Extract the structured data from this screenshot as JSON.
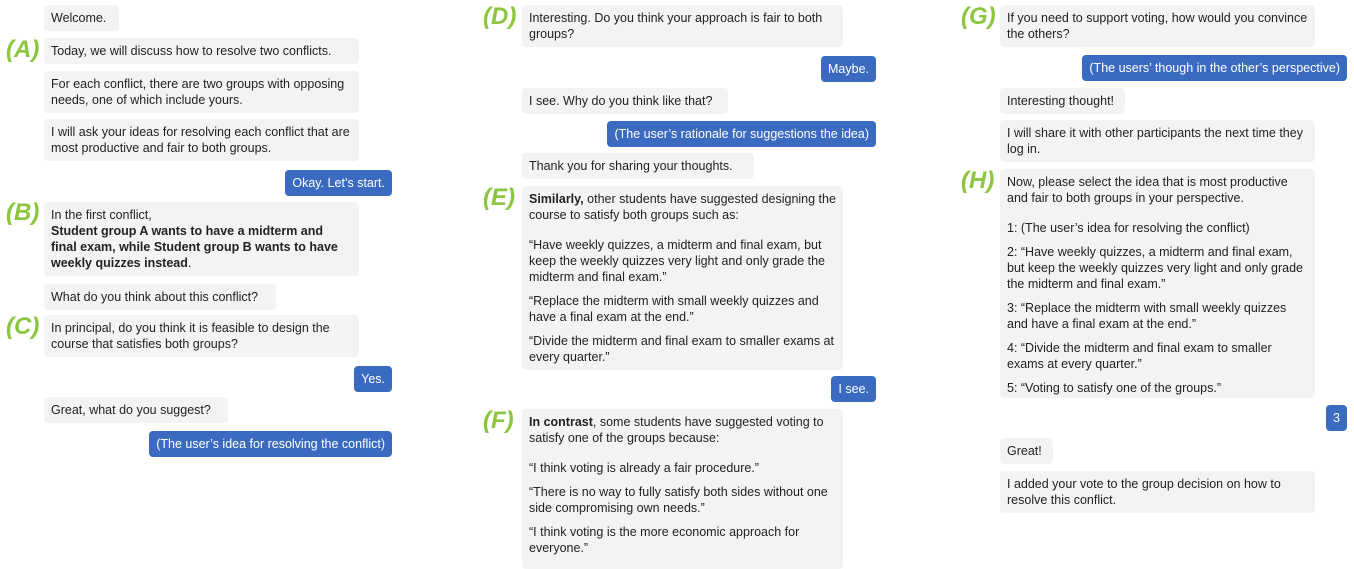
{
  "col1": {
    "welcome": "Welcome.",
    "marker_a": "(A)",
    "today": "Today, we will discuss how to resolve two conflicts.",
    "for_each": "For each conflict, there are two groups with opposing needs, one of which include yours.",
    "ask_ideas": "I will ask your ideas for resolving each conflict that are most productive and fair to both groups.",
    "okay": "Okay. Let’s start.",
    "marker_b": "(B)",
    "first_conflict": "In the first conflict,",
    "conflict_bold": "Student group A wants to have a midterm and final exam, while Student group B wants to have weekly quizzes instead",
    "conflict_end": ".",
    "what_think": "What do you think about this conflict?",
    "marker_c": "(C)",
    "feasible": "In principal, do you think it is feasible to design the course that satisfies both groups?",
    "yes": "Yes.",
    "great_suggest": "Great, what do you suggest?",
    "user_idea": "(The user’s idea for resolving the conflict)"
  },
  "col2": {
    "marker_d": "(D)",
    "fair": "Interesting. Do you think your approach is fair to both groups?",
    "maybe": "Maybe.",
    "why": "I see. Why do you think like that?",
    "rationale": "(The user’s rationale for suggestions the idea)",
    "thanks": "Thank you for sharing your thoughts.",
    "marker_e": "(E)",
    "similarly_bold": "Similarly,",
    "similarly_rest": " other students have suggested designing the course to satisfy both groups such as:",
    "quote1": "“Have weekly quizzes, a midterm and final exam, but keep the weekly quizzes very light and only grade the midterm and final exam.”",
    "quote2": "“Replace the midterm with small weekly quizzes and have a final exam at the end.”",
    "quote3": "“Divide the midterm and final exam to smaller exams at every quarter.”",
    "isee": "I see.",
    "marker_f": "(F)",
    "contrast_bold": "In contrast",
    "contrast_rest": ", some students have suggested voting to satisfy one of the groups because:",
    "vote1": "“I think voting is already a fair procedure.”",
    "vote2": "“There is no way to fully satisfy both sides without one side compromising own needs.”",
    "vote3": "“I think voting is the more economic approach for everyone.”"
  },
  "col3": {
    "marker_g": "(G)",
    "convince": "If you need to support voting, how would you convince the others?",
    "users_though": "(The users’ though in the other’s perspective)",
    "interesting": "Interesting thought!",
    "share": "I will share it with other participants the next time they log in.",
    "marker_h": "(H)",
    "select": "Now, please select the idea that is most productive and fair to both groups in your perspective.",
    "opt1": "1:  (The user’s idea for resolving the conflict)",
    "opt2": "2:  “Have weekly quizzes, a midterm and final exam, but keep the weekly quizzes very light and only grade the midterm and final exam.”",
    "opt3": "3:  “Replace the midterm with small weekly quizzes and have a final exam at the end.”",
    "opt4": "4:  “Divide the midterm and final exam to smaller exams at every quarter.”",
    "opt5": "5:  “Voting to satisfy one of the groups.”",
    "choice": "3",
    "great": "Great!",
    "added": "I added your vote to the group decision on how to resolve this conflict."
  },
  "colors": {
    "user_bubble": "#3a6bc1",
    "bot_bubble": "#f2f3f5",
    "marker": "#8cc63f"
  }
}
